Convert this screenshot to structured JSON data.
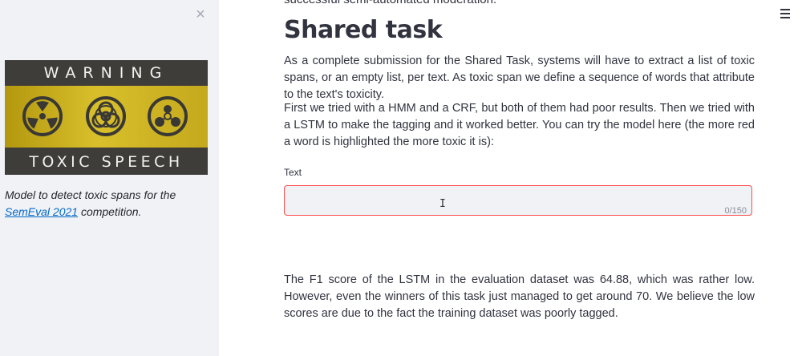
{
  "sidebar": {
    "close_icon": "close-icon",
    "close_glyph": "×",
    "banner": {
      "top_text": "WARNING",
      "bottom_text": "TOXIC SPEECH",
      "icons": [
        "radiation-icon",
        "biohazard-icon",
        "chemical-weapon-icon"
      ]
    },
    "caption": {
      "prefix": "Model to detect toxic spans for the ",
      "link_text": "SemEval 2021",
      "suffix": " competition."
    }
  },
  "main": {
    "top_cut_text": "successful semi-automated moderation.",
    "heading": "Shared task",
    "paragraph1": "As a complete submission for the Shared Task, systems will have to extract a list of toxic spans, or an empty list, per text. As toxic span we define a sequence of words that attribute to the text's toxicity.",
    "paragraph2": "First we tried with a HMM and a CRF, but both of them had poor results. Then we tried with a LSTM to make the tagging and it worked better. You can try the model here (the more red a word is highlighted the more toxic it is):",
    "input": {
      "label": "Text",
      "value": "",
      "counter": "0/150"
    },
    "paragraph3": "The F1 score of the LSTM in the evaluation dataset was 64.88, which was rather low. However, even the winners of this task just managed to get around 70. We believe the low scores are due to the fact the training dataset was poorly tagged."
  },
  "menu_icon": "hamburger-menu-icon",
  "colors": {
    "sidebar_bg": "#f0f2f6",
    "input_border": "#ff4b4b",
    "link": "#0068c9",
    "banner_yellow": "#d8bf2a"
  }
}
